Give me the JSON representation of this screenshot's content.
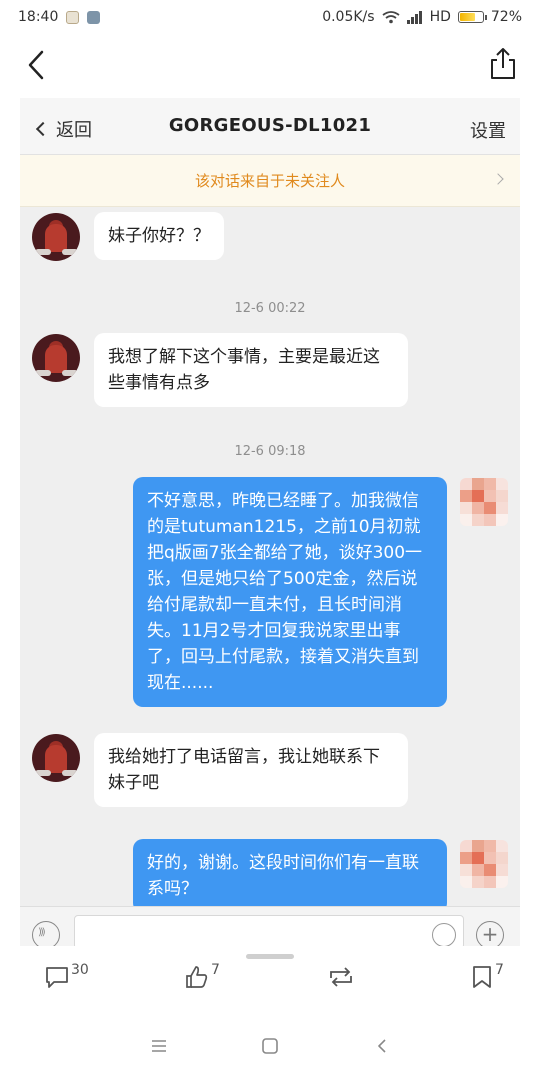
{
  "status_bar": {
    "time": "18:40",
    "network_speed": "0.05K/s",
    "hd_label": "HD",
    "battery_percent": "72%",
    "battery_level": 0.72
  },
  "app_top": {
    "back_icon": "chevron-left-icon",
    "share_icon": "share-icon"
  },
  "chat": {
    "back_label": "返回",
    "title": "GORGEOUS-DL1021",
    "settings_label": "设置",
    "banner_text": "该对话来自于未关注人",
    "messages": [
      {
        "side": "in",
        "text": "妹子你好？？"
      },
      {
        "timestamp": "12-6 00:22"
      },
      {
        "side": "in",
        "text": "我想了解下这个事情，主要是最近这些事情有点多"
      },
      {
        "timestamp": "12-6 09:18"
      },
      {
        "side": "out",
        "text": "不好意思，昨晚已经睡了。加我微信的是tutuman1215，之前10月初就把q版画7张全都给了她，谈好300一张，但是她只给了500定金，然后说给付尾款却一直未付，且长时间消失。11月2号才回复我说家里出事了，回马上付尾款，接着又消失直到现在......"
      },
      {
        "side": "in",
        "text": "我给她打了电话留言，我让她联系下妹子吧"
      },
      {
        "side": "out",
        "text": "好的，谢谢。这段时间你们有一直联系吗？"
      }
    ],
    "input_bar": {
      "voice_icon": "voice-icon",
      "emoji_icon": "emoji-icon",
      "plus_label": "+"
    }
  },
  "actions": {
    "comment_count": "30",
    "like_count": "7",
    "repost_icon": "repost-icon",
    "bookmark_count": "7"
  },
  "nav": {
    "menu_icon": "menu-icon",
    "home_icon": "home-square-icon",
    "back_icon": "nav-back-icon"
  }
}
